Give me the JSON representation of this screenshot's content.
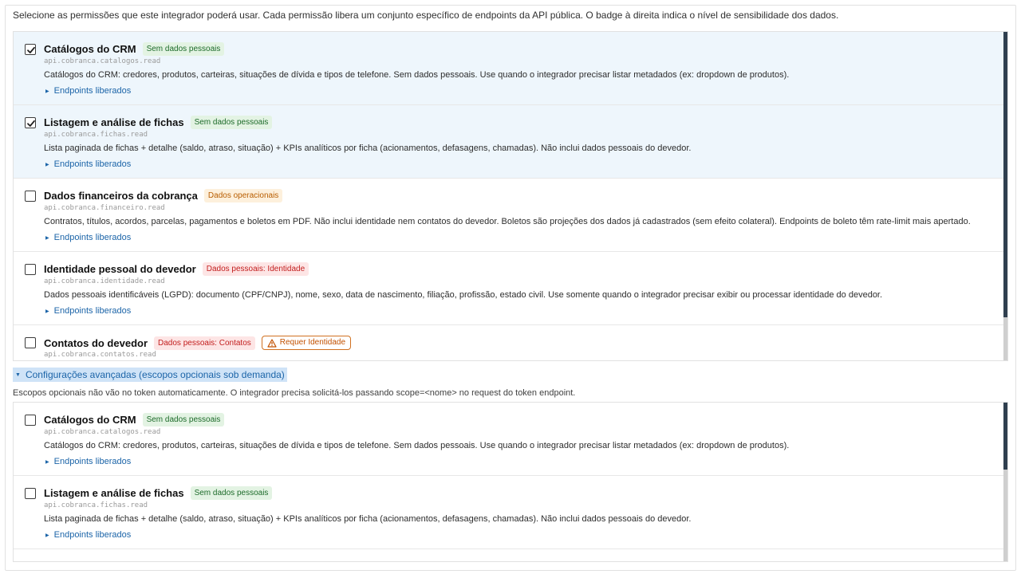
{
  "intro_text": "Selecione as permissões que este integrador poderá usar. Cada permissão libera um conjunto específico de endpoints da API pública. O badge à direita indica o nível de sensibilidade dos dados.",
  "endpoints_label": "Endpoints liberados",
  "primary_scopes": [
    {
      "checked": true,
      "title": "Catálogos do CRM",
      "badge": "Sem dados pessoais",
      "badge_type": "green",
      "scope": "api.cobranca.catalogos.read",
      "description": "Catálogos do CRM: credores, produtos, carteiras, situações de dívida e tipos de telefone. Sem dados pessoais. Use quando o integrador precisar listar metadados (ex: dropdown de produtos)."
    },
    {
      "checked": true,
      "title": "Listagem e análise de fichas",
      "badge": "Sem dados pessoais",
      "badge_type": "green",
      "scope": "api.cobranca.fichas.read",
      "description": "Lista paginada de fichas + detalhe (saldo, atraso, situação) + KPIs analíticos por ficha (acionamentos, defasagens, chamadas). Não inclui dados pessoais do devedor."
    },
    {
      "checked": false,
      "title": "Dados financeiros da cobrança",
      "badge": "Dados operacionais",
      "badge_type": "orange",
      "scope": "api.cobranca.financeiro.read",
      "description": "Contratos, títulos, acordos, parcelas, pagamentos e boletos em PDF. Não inclui identidade nem contatos do devedor. Boletos são projeções dos dados já cadastrados (sem efeito colateral). Endpoints de boleto têm rate-limit mais apertado."
    },
    {
      "checked": false,
      "title": "Identidade pessoal do devedor",
      "badge": "Dados pessoais: Identidade",
      "badge_type": "red",
      "scope": "api.cobranca.identidade.read",
      "description": "Dados pessoais identificáveis (LGPD): documento (CPF/CNPJ), nome, sexo, data de nascimento, filiação, profissão, estado civil. Use somente quando o integrador precisar exibir ou processar identidade do devedor."
    },
    {
      "checked": false,
      "title": "Contatos do devedor",
      "badge": "Dados pessoais: Contatos",
      "badge_type": "red",
      "warning": "Requer Identidade",
      "scope": "api.cobranca.contatos.read"
    }
  ],
  "advanced": {
    "toggle_label": "Configurações avançadas (escopos opcionais sob demanda)",
    "note": "Escopos opcionais não vão no token automaticamente. O integrador precisa solicitá-los passando scope=<nome> no request do token endpoint."
  },
  "optional_scopes": [
    {
      "checked": false,
      "title": "Catálogos do CRM",
      "badge": "Sem dados pessoais",
      "badge_type": "green",
      "scope": "api.cobranca.catalogos.read",
      "description": "Catálogos do CRM: credores, produtos, carteiras, situações de dívida e tipos de telefone. Sem dados pessoais. Use quando o integrador precisar listar metadados (ex: dropdown de produtos)."
    },
    {
      "checked": false,
      "title": "Listagem e análise de fichas",
      "badge": "Sem dados pessoais",
      "badge_type": "green",
      "scope": "api.cobranca.fichas.read",
      "description": "Lista paginada de fichas + detalhe (saldo, atraso, situação) + KPIs analíticos por ficha (acionamentos, defasagens, chamadas). Não inclui dados pessoais do devedor."
    }
  ]
}
